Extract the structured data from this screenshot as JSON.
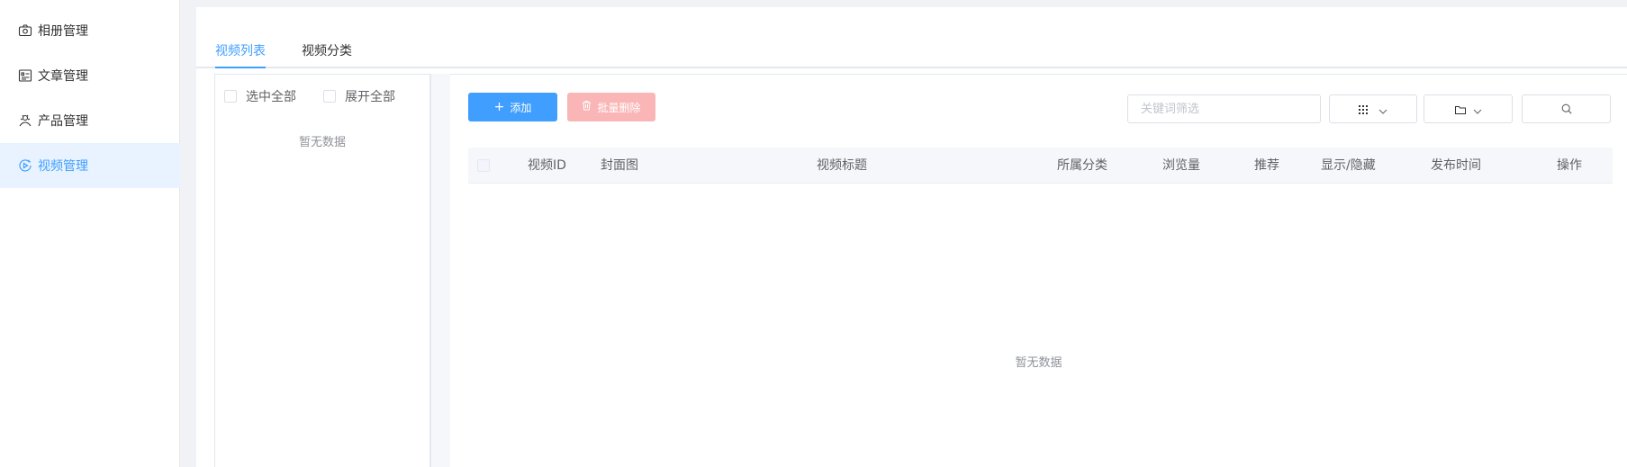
{
  "sidebar": {
    "items": [
      {
        "label": "相册管理",
        "icon": "camera-icon",
        "active": false
      },
      {
        "label": "文章管理",
        "icon": "article-icon",
        "active": false
      },
      {
        "label": "产品管理",
        "icon": "product-icon",
        "active": false
      },
      {
        "label": "视频管理",
        "icon": "video-icon",
        "active": true
      }
    ]
  },
  "tabs": [
    {
      "label": "视频列表",
      "active": true
    },
    {
      "label": "视频分类",
      "active": false
    }
  ],
  "category_panel": {
    "select_all_label": "选中全部",
    "expand_all_label": "展开全部",
    "empty_text": "暂无数据"
  },
  "toolbar": {
    "add_label": "添加",
    "batch_delete_label": "批量删除",
    "search_placeholder": "关键词筛选",
    "view_icon": "grid-icon",
    "folder_icon": "folder-icon",
    "search_icon": "search-icon"
  },
  "table": {
    "columns": [
      "视频ID",
      "封面图",
      "视频标题",
      "所属分类",
      "浏览量",
      "推荐",
      "显示/隐藏",
      "发布时间",
      "操作"
    ],
    "rows": [],
    "empty_text": "暂无数据"
  },
  "colors": {
    "primary": "#409eff",
    "danger_disabled": "#fab6b6",
    "active_bg": "#e8f3ff"
  }
}
